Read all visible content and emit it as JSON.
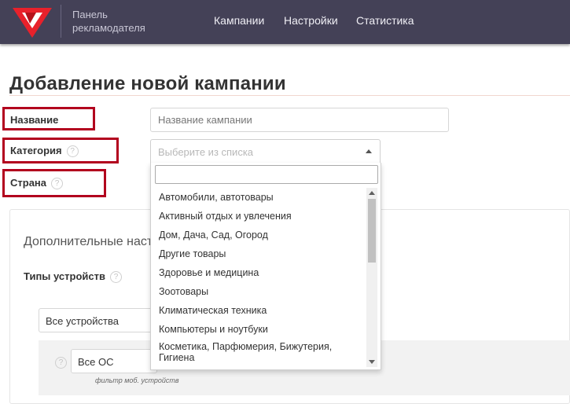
{
  "header": {
    "brand_line1": "Панель",
    "brand_line2": "рекламодателя",
    "nav": [
      "Кампании",
      "Настройки",
      "Статистика"
    ]
  },
  "page": {
    "title": "Добавление новой кампании"
  },
  "form": {
    "name_label": "Название",
    "name_placeholder": "Название кампании",
    "category_label": "Категория",
    "category_placeholder": "Выберите из списка",
    "country_label": "Страна",
    "help_glyph": "?"
  },
  "dropdown": {
    "search_value": "",
    "items": [
      "Автомобили, автотовары",
      "Активный отдых и увлечения",
      "Дом, Дача, Сад, Огород",
      "Другие товары",
      "Здоровье и медицина",
      "Зоотовары",
      "Климатическая техника",
      "Компьютеры и ноутбуки",
      "Косметика, Парфюмерия, Бижутерия, Гигиена"
    ]
  },
  "additional": {
    "title": "Дополнительные настройки",
    "device_types_label": "Типы устройств",
    "device_select_value": "Все устройства",
    "os_select_value": "Все ОС",
    "os_note": "фильтр моб. устройств"
  },
  "colors": {
    "header_bg": "#444157",
    "highlight_box": "#b2001e",
    "logo_red": "#e8212b"
  },
  "icons": {
    "logo": "brand-logo-icon",
    "help": "question-circle-icon",
    "search": "search-icon",
    "caret": "caret-up-icon"
  }
}
